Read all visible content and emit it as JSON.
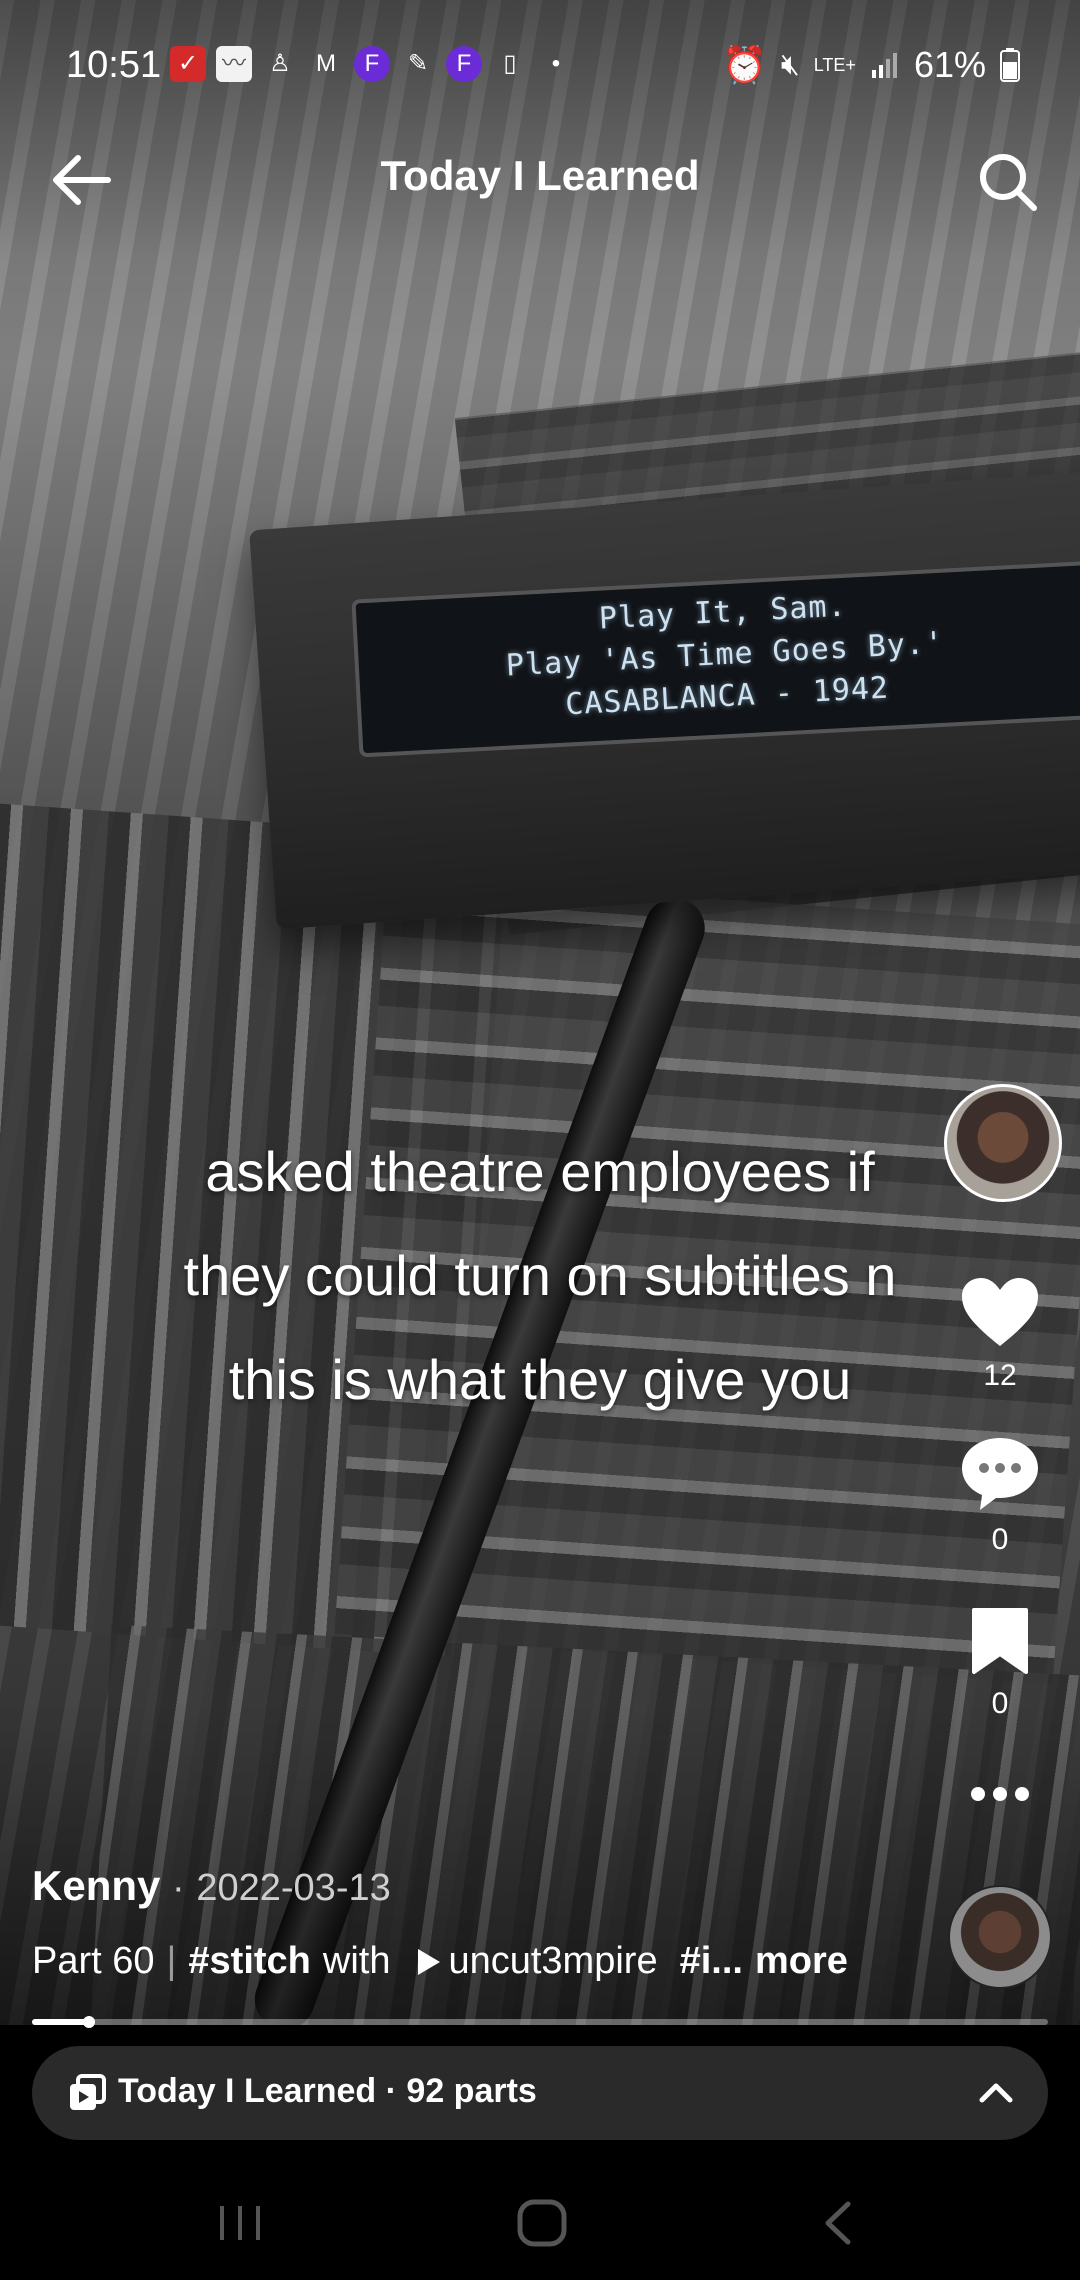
{
  "status_bar": {
    "time": "10:51",
    "battery": "61%",
    "network": "LTE+"
  },
  "header": {
    "title": "Today I Learned"
  },
  "video": {
    "device_display": [
      "Play It, Sam.",
      "Play 'As Time Goes By.'",
      "CASABLANCA - 1942"
    ],
    "caption": [
      "asked theatre employees if",
      "they could turn on subtitles n",
      "this is what they give you"
    ]
  },
  "actions": {
    "likes": "12",
    "comments": "0",
    "saves": "0"
  },
  "post": {
    "author": "Kenny",
    "date_separator": "·",
    "date": "2022-03-13",
    "part": "Part 60",
    "separator": "|",
    "hashtag_stitch": "#stitch",
    "with_word": "with",
    "mentioned_user": "uncut3mpire",
    "hashtag_truncated": "#i...",
    "more_label": "more"
  },
  "playback": {
    "progress": 0.056
  },
  "playlist_bar": {
    "label": "Today I Learned · 92 parts"
  }
}
